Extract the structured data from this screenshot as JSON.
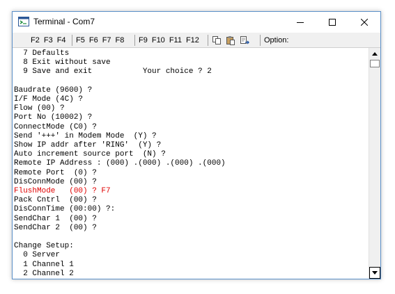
{
  "window": {
    "title": "Terminal - Com7"
  },
  "toolbar": {
    "group1": [
      "F2",
      "F3",
      "F4"
    ],
    "group2": [
      "F5",
      "F6",
      "F7",
      "F8"
    ],
    "group3": [
      "F9",
      "F10",
      "F11",
      "F12"
    ],
    "icons": [
      "copy-icon",
      "paste-icon",
      "send-file-icon"
    ],
    "options_label": "Option:"
  },
  "terminal": {
    "lines": [
      {
        "text": "  7 Defaults",
        "color": "#000000"
      },
      {
        "text": "  8 Exit without save",
        "color": "#000000"
      },
      {
        "text": "  9 Save and exit           Your choice ? 2",
        "color": "#000000"
      },
      {
        "text": "",
        "color": "#000000"
      },
      {
        "text": "Baudrate (9600) ?",
        "color": "#000000"
      },
      {
        "text": "I/F Mode (4C) ?",
        "color": "#000000"
      },
      {
        "text": "Flow (00) ?",
        "color": "#000000"
      },
      {
        "text": "Port No (10002) ?",
        "color": "#000000"
      },
      {
        "text": "ConnectMode (C0) ?",
        "color": "#000000"
      },
      {
        "text": "Send '+++' in Modem Mode  (Y) ?",
        "color": "#000000"
      },
      {
        "text": "Show IP addr after 'RING'  (Y) ?",
        "color": "#000000"
      },
      {
        "text": "Auto increment source port  (N) ?",
        "color": "#000000"
      },
      {
        "text": "Remote IP Address : (000) .(000) .(000) .(000)",
        "color": "#000000"
      },
      {
        "text": "Remote Port  (0) ?",
        "color": "#000000"
      },
      {
        "text": "DisConnMode (00) ?",
        "color": "#000000"
      },
      {
        "text": "FlushMode   (00) ? F7",
        "color": "#e00000"
      },
      {
        "text": "Pack Cntrl  (00) ?",
        "color": "#000000"
      },
      {
        "text": "DisConnTime (00:00) ?:",
        "color": "#000000"
      },
      {
        "text": "SendChar 1  (00) ?",
        "color": "#000000"
      },
      {
        "text": "SendChar 2  (00) ?",
        "color": "#000000"
      },
      {
        "text": "",
        "color": "#000000"
      },
      {
        "text": "Change Setup:",
        "color": "#000000"
      },
      {
        "text": "  0 Server",
        "color": "#000000"
      },
      {
        "text": "  1 Channel 1",
        "color": "#000000"
      },
      {
        "text": "  2 Channel 2",
        "color": "#000000"
      }
    ]
  },
  "colors": {
    "window_border": "#5a8fc8",
    "toolbar_bg": "#f0f0f0",
    "highlight": "#e00000"
  }
}
